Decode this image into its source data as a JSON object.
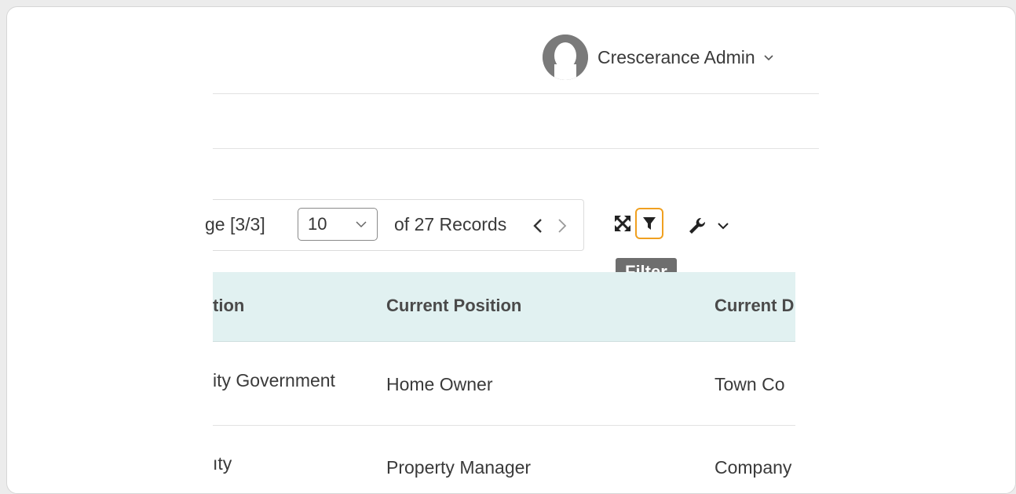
{
  "header": {
    "user_name": "Crescerance Admin"
  },
  "toolbar": {
    "page_label": "ge [3/3]",
    "per_page_value": "10",
    "records_label": "of 27 Records",
    "filter_tooltip": "Filter",
    "accent_color": "#f0a020"
  },
  "table": {
    "columns": [
      "tion",
      "Current Position",
      "Current D"
    ],
    "rows": [
      [
        "ity Government",
        "Home Owner",
        "Town Co"
      ],
      [
        "ıty",
        "Property Manager",
        "Company"
      ]
    ],
    "header_bg": "#e1f1f1"
  }
}
